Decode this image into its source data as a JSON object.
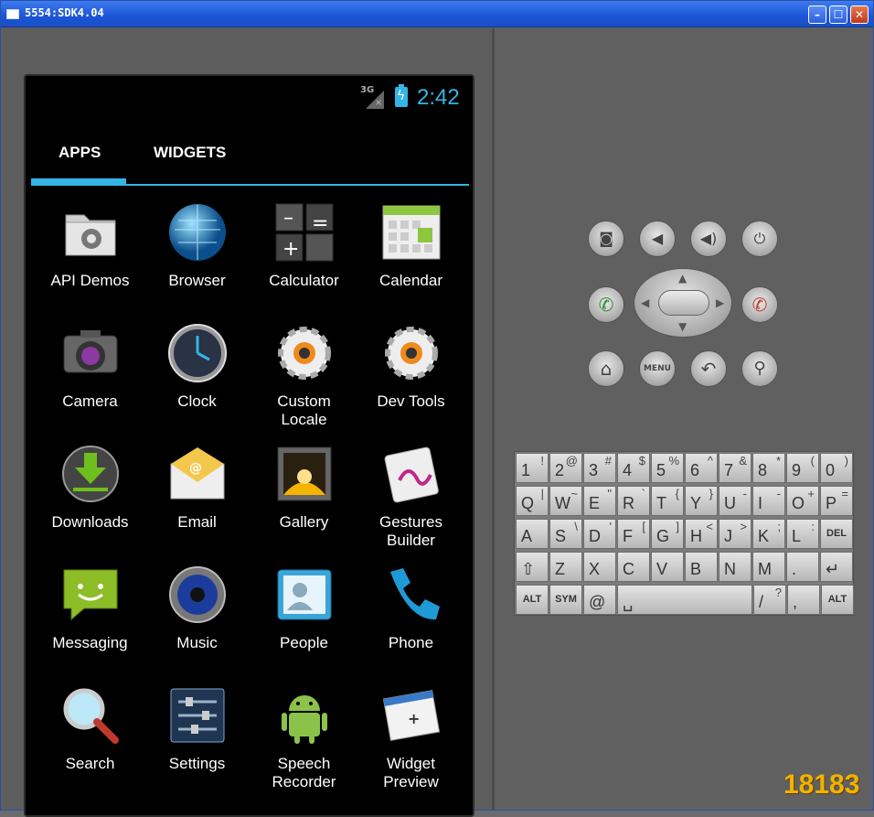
{
  "window": {
    "title": "5554:SDK4.04"
  },
  "status_bar": {
    "network": "3G",
    "time": "2:42"
  },
  "tabs": [
    {
      "label": "APPS"
    },
    {
      "label": "WIDGETS"
    }
  ],
  "apps": [
    {
      "label": "API Demos",
      "icon": "folder-gear-icon"
    },
    {
      "label": "Browser",
      "icon": "globe-icon"
    },
    {
      "label": "Calculator",
      "icon": "calculator-icon"
    },
    {
      "label": "Calendar",
      "icon": "calendar-icon"
    },
    {
      "label": "Camera",
      "icon": "camera-icon"
    },
    {
      "label": "Clock",
      "icon": "clock-icon"
    },
    {
      "label": "Custom\nLocale",
      "icon": "gear-icon"
    },
    {
      "label": "Dev Tools",
      "icon": "gear-icon"
    },
    {
      "label": "Downloads",
      "icon": "download-icon"
    },
    {
      "label": "Email",
      "icon": "email-icon"
    },
    {
      "label": "Gallery",
      "icon": "gallery-icon"
    },
    {
      "label": "Gestures\nBuilder",
      "icon": "gestures-icon"
    },
    {
      "label": "Messaging",
      "icon": "messaging-icon"
    },
    {
      "label": "Music",
      "icon": "speaker-icon"
    },
    {
      "label": "People",
      "icon": "contacts-icon"
    },
    {
      "label": "Phone",
      "icon": "phone-icon"
    },
    {
      "label": "Search",
      "icon": "magnifier-icon"
    },
    {
      "label": "Settings",
      "icon": "sliders-icon"
    },
    {
      "label": "Speech\nRecorder",
      "icon": "android-icon"
    },
    {
      "label": "Widget\nPreview",
      "icon": "widget-preview-icon"
    }
  ],
  "controls": {
    "menu_label": "MENU"
  },
  "keyboard": {
    "row1": [
      [
        "1",
        "!"
      ],
      [
        "2",
        "@"
      ],
      [
        "3",
        "#"
      ],
      [
        "4",
        "$"
      ],
      [
        "5",
        "%"
      ],
      [
        "6",
        "^"
      ],
      [
        "7",
        "&"
      ],
      [
        "8",
        "*"
      ],
      [
        "9",
        "("
      ],
      [
        "0",
        ")"
      ]
    ],
    "row2": [
      [
        "Q",
        "|"
      ],
      [
        "W",
        "~"
      ],
      [
        "E",
        "\""
      ],
      [
        "R",
        "`"
      ],
      [
        "T",
        "{"
      ],
      [
        "Y",
        "}"
      ],
      [
        "U",
        "-"
      ],
      [
        "I",
        "-"
      ],
      [
        "O",
        "+"
      ],
      [
        "P",
        "="
      ]
    ],
    "row3": [
      [
        "A",
        ""
      ],
      [
        "S",
        "\\"
      ],
      [
        "D",
        "'"
      ],
      [
        "F",
        "["
      ],
      [
        "G",
        "]"
      ],
      [
        "H",
        "<"
      ],
      [
        "J",
        ">"
      ],
      [
        "K",
        ";"
      ],
      [
        "L",
        ":"
      ],
      [
        "DEL",
        ""
      ]
    ],
    "row4": [
      [
        "⇧",
        ""
      ],
      [
        "Z",
        ""
      ],
      [
        "X",
        ""
      ],
      [
        "C",
        ""
      ],
      [
        "V",
        ""
      ],
      [
        "B",
        ""
      ],
      [
        "N",
        ""
      ],
      [
        "M",
        ""
      ],
      [
        ".",
        ""
      ],
      [
        "↵",
        ""
      ]
    ],
    "row5": {
      "alt_left": "ALT",
      "sym": "SYM",
      "at": "@",
      "space": "␣",
      "slash": "/",
      "question": "?",
      "comma": ",",
      "alt_right": "ALT"
    }
  },
  "watermark": {
    "text": "18183"
  }
}
